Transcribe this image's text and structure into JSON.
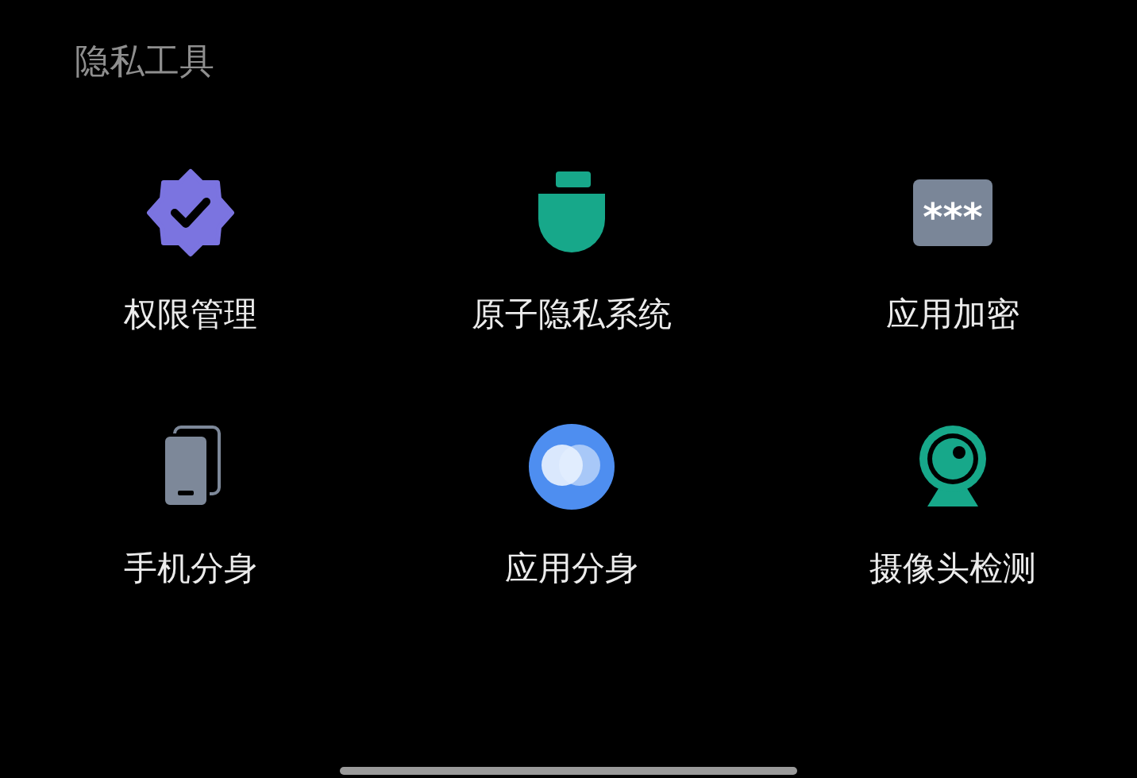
{
  "section": {
    "title": "隐私工具"
  },
  "tools": [
    {
      "label": "权限管理",
      "kind": "badge-check"
    },
    {
      "label": "原子隐私系统",
      "kind": "shield"
    },
    {
      "label": "应用加密",
      "kind": "password",
      "icon_text": "***"
    },
    {
      "label": "手机分身",
      "kind": "phones"
    },
    {
      "label": "应用分身",
      "kind": "circles"
    },
    {
      "label": "摄像头检测",
      "kind": "webcam"
    }
  ]
}
